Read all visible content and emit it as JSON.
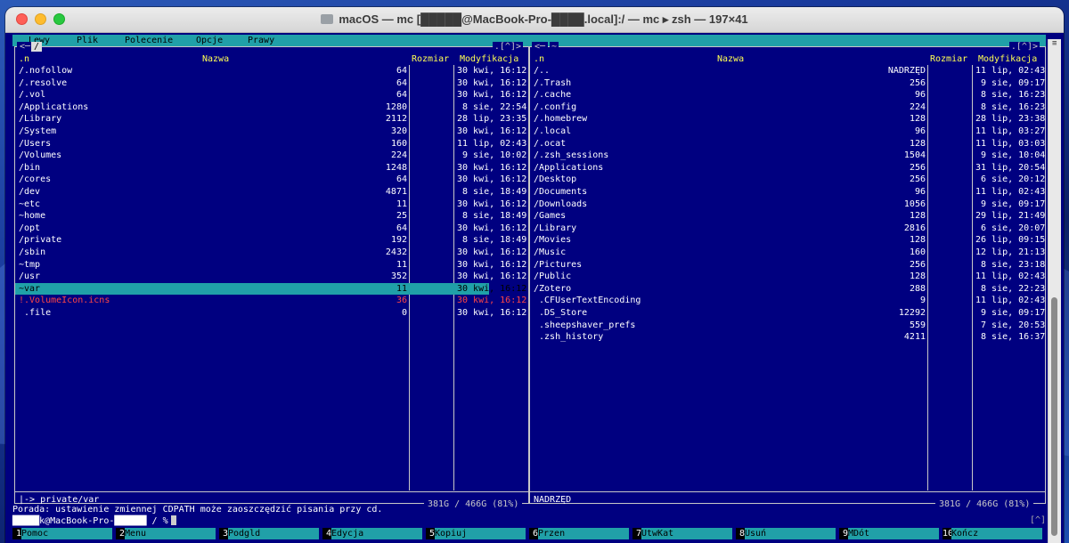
{
  "window": {
    "title": "macOS — mc [█████@MacBook-Pro-████.local]:/ — mc ▸ zsh — 197×41"
  },
  "menubar": [
    "Lewy",
    "Plik",
    "Polecenie",
    "Opcje",
    "Prawy"
  ],
  "left_panel": {
    "path": "/",
    "scroll_indicator": ".[^]>",
    "headers": {
      "name_prefix": ".n",
      "name": "Nazwa",
      "size": "Rozmiar",
      "mtime": "Modyfikacja"
    },
    "rows": [
      {
        "name": "/.nofollow",
        "size": "64",
        "mtime": "30 kwi, 16:12"
      },
      {
        "name": "/.resolve",
        "size": "64",
        "mtime": "30 kwi, 16:12"
      },
      {
        "name": "/.vol",
        "size": "64",
        "mtime": "30 kwi, 16:12"
      },
      {
        "name": "/Applications",
        "size": "1280",
        "mtime": " 8 sie, 22:54"
      },
      {
        "name": "/Library",
        "size": "2112",
        "mtime": "28 lip, 23:35"
      },
      {
        "name": "/System",
        "size": "320",
        "mtime": "30 kwi, 16:12"
      },
      {
        "name": "/Users",
        "size": "160",
        "mtime": "11 lip, 02:43"
      },
      {
        "name": "/Volumes",
        "size": "224",
        "mtime": " 9 sie, 10:02"
      },
      {
        "name": "/bin",
        "size": "1248",
        "mtime": "30 kwi, 16:12"
      },
      {
        "name": "/cores",
        "size": "64",
        "mtime": "30 kwi, 16:12"
      },
      {
        "name": "/dev",
        "size": "4871",
        "mtime": " 8 sie, 18:49"
      },
      {
        "name": "~etc",
        "size": "11",
        "mtime": "30 kwi, 16:12"
      },
      {
        "name": "~home",
        "size": "25",
        "mtime": " 8 sie, 18:49"
      },
      {
        "name": "/opt",
        "size": "64",
        "mtime": "30 kwi, 16:12"
      },
      {
        "name": "/private",
        "size": "192",
        "mtime": " 8 sie, 18:49"
      },
      {
        "name": "/sbin",
        "size": "2432",
        "mtime": "30 kwi, 16:12"
      },
      {
        "name": "~tmp",
        "size": "11",
        "mtime": "30 kwi, 16:12"
      },
      {
        "name": "/usr",
        "size": "352",
        "mtime": "30 kwi, 16:12"
      },
      {
        "name": "~var",
        "size": "11",
        "mtime": "30 kwi, 16:12",
        "selected": true
      },
      {
        "name": "!.VolumeIcon.icns",
        "size": "36",
        "mtime": "30 kwi, 16:12",
        "red": true
      },
      {
        "name": " .file",
        "size": "0",
        "mtime": "30 kwi, 16:12"
      }
    ],
    "mini_status": "|-> private/var",
    "disk": "381G / 466G (81%)"
  },
  "right_panel": {
    "path": "~",
    "scroll_indicator": ".[^]>",
    "headers": {
      "name_prefix": ".n",
      "name": "Nazwa",
      "size": "Rozmiar",
      "mtime": "Modyfikacja"
    },
    "rows": [
      {
        "name": "/..",
        "size": "NADRZĘD",
        "mtime": "11 lip, 02:43"
      },
      {
        "name": "/.Trash",
        "size": "256",
        "mtime": " 9 sie, 09:17"
      },
      {
        "name": "/.cache",
        "size": "96",
        "mtime": " 8 sie, 16:23"
      },
      {
        "name": "/.config",
        "size": "224",
        "mtime": " 8 sie, 16:23"
      },
      {
        "name": "/.homebrew",
        "size": "128",
        "mtime": "28 lip, 23:38"
      },
      {
        "name": "/.local",
        "size": "96",
        "mtime": "11 lip, 03:27"
      },
      {
        "name": "/.ocat",
        "size": "128",
        "mtime": "11 lip, 03:03"
      },
      {
        "name": "/.zsh_sessions",
        "size": "1504",
        "mtime": " 9 sie, 10:04"
      },
      {
        "name": "/Applications",
        "size": "256",
        "mtime": "31 lip, 20:54"
      },
      {
        "name": "/Desktop",
        "size": "256",
        "mtime": " 6 sie, 20:12"
      },
      {
        "name": "/Documents",
        "size": "96",
        "mtime": "11 lip, 02:43"
      },
      {
        "name": "/Downloads",
        "size": "1056",
        "mtime": " 9 sie, 09:17"
      },
      {
        "name": "/Games",
        "size": "128",
        "mtime": "29 lip, 21:49"
      },
      {
        "name": "/Library",
        "size": "2816",
        "mtime": " 6 sie, 20:07"
      },
      {
        "name": "/Movies",
        "size": "128",
        "mtime": "26 lip, 09:15"
      },
      {
        "name": "/Music",
        "size": "160",
        "mtime": "12 lip, 21:13"
      },
      {
        "name": "/Pictures",
        "size": "256",
        "mtime": " 8 sie, 23:18"
      },
      {
        "name": "/Public",
        "size": "128",
        "mtime": "11 lip, 02:43"
      },
      {
        "name": "/Zotero",
        "size": "288",
        "mtime": " 8 sie, 22:23"
      },
      {
        "name": " .CFUserTextEncoding",
        "size": "9",
        "mtime": "11 lip, 02:43"
      },
      {
        "name": " .DS_Store",
        "size": "12292",
        "mtime": " 9 sie, 09:17"
      },
      {
        "name": " .sheepshaver_prefs",
        "size": "559",
        "mtime": " 7 sie, 20:53"
      },
      {
        "name": " .zsh_history",
        "size": "4211",
        "mtime": " 8 sie, 16:37"
      }
    ],
    "mini_status": "NADRZĘD",
    "disk": "381G / 466G (81%)"
  },
  "hint": "Porada: ustawienie zmiennej CDPATH może zaoszczędzić pisania przy cd.",
  "prompt": "█████k@MacBook-Pro-██████ / %",
  "prompt_bracket": "[^]",
  "fkeys": [
    {
      "num": "1",
      "label": "Pomoc"
    },
    {
      "num": "2",
      "label": "Menu"
    },
    {
      "num": "3",
      "label": "Podgld"
    },
    {
      "num": "4",
      "label": "Edycja"
    },
    {
      "num": "5",
      "label": "Kopiuj"
    },
    {
      "num": "6",
      "label": "Przen"
    },
    {
      "num": "7",
      "label": "UtwKat"
    },
    {
      "num": "8",
      "label": "Usuń"
    },
    {
      "num": "9",
      "label": "MDót"
    },
    {
      "num": "10",
      "label": "Kończ"
    }
  ]
}
